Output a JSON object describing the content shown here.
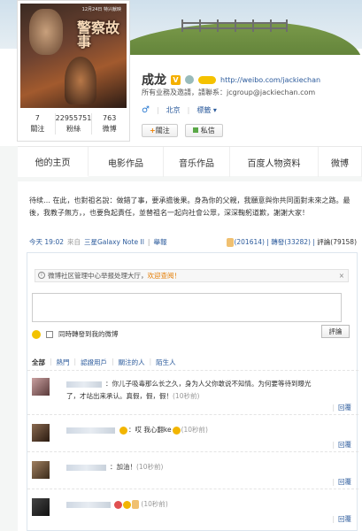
{
  "profile": {
    "name": "成龙",
    "url": "http://weibo.com/jackiechan",
    "business": "所有业務及邀請，請聯系：jcgroup@jackiechan.com",
    "location": "北京",
    "tag_link": "標籤 ▾",
    "poster_title": "警察故事",
    "poster_date": "12月24日 特兴献映",
    "stats": [
      {
        "value": "7",
        "label": "關注"
      },
      {
        "value": "22955751",
        "label": "粉絲"
      },
      {
        "value": "763",
        "label": "微博"
      }
    ],
    "follow_label": "關注",
    "message_label": "私信"
  },
  "tabs": [
    "他的主页",
    "电影作品",
    "音乐作品",
    "百度人物资料",
    "微博"
  ],
  "post": {
    "text": "待续… 在此，也對祖名說：做錯了事，要承擔後果。身為你的父親，我願意與你共同面對未來之路。最後，我教子無方，，也要負起責任，並替祖名一起向社會公眾，深深鞠躬道歉，謝謝大家！",
    "time": "今天 19:02",
    "source_prefix": "來自",
    "source": "三星Galaxy Note II",
    "report": "舉報",
    "likes": "(201614)",
    "reposts": "轉發(33282)",
    "comments": "評論(79158)",
    "sep": "|"
  },
  "comments_panel": {
    "notice": "微博社区管理中心举报处理大厅，",
    "notice_link": "欢迎查阅！",
    "notice_close": "×",
    "info_glyph": "i",
    "also_repost": "同時轉發到我的微博",
    "submit": "評論",
    "filters": [
      "全部",
      "熱門",
      "認證用戶",
      "關注的人",
      "陌生人"
    ],
    "items": [
      {
        "text": "：你儿子吸毒那么长之久，身为人父你敢说不知情。为何要等待到曝光了，才站出来承认。真假，假，假！",
        "time": "(10秒前)"
      },
      {
        "text": "：哎 我心翻ke",
        "time": "(10秒前)"
      },
      {
        "text": "：加油！",
        "time": "(10秒前)"
      },
      {
        "text": "",
        "time": "(10秒前)"
      },
      {
        "text": "",
        "time": ""
      }
    ],
    "reply_label": "回覆",
    "reply_sep": "|"
  },
  "colors": {
    "link": "#2c5b9c",
    "accent": "#e47b00",
    "vip": "#f5b000"
  },
  "icons": [
    "vip-v-icon",
    "gender-male-icon",
    "plus-icon",
    "mail-icon",
    "like-icon",
    "info-icon",
    "close-icon",
    "smile-icon"
  ]
}
